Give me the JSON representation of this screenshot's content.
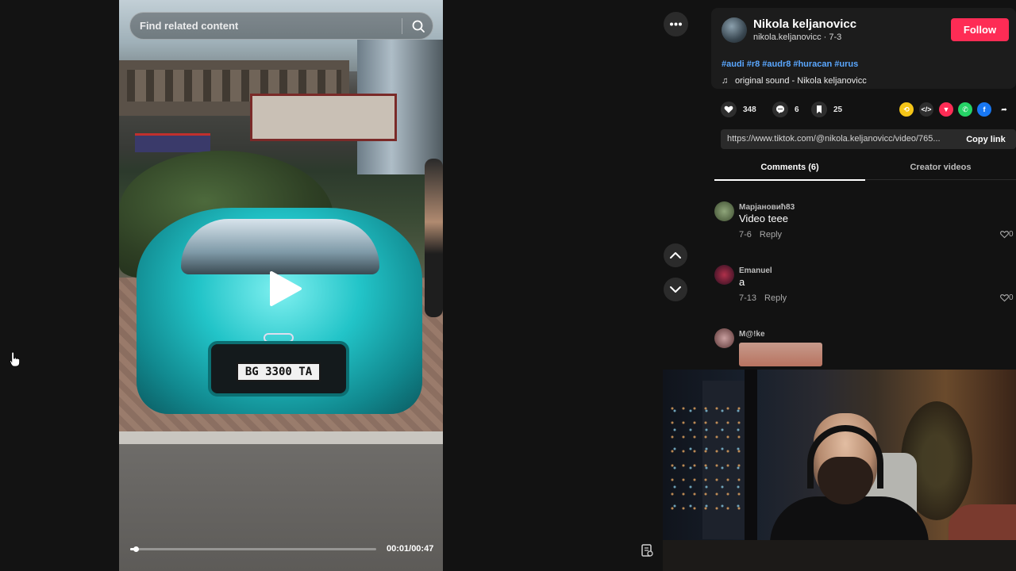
{
  "search": {
    "placeholder": "Find related content"
  },
  "video": {
    "plate_text": "BG 3300 TA",
    "time": "00:01/00:47",
    "progress": 0.021
  },
  "author": {
    "name": "Nikola keljanovicc",
    "handle_date": "nikola.keljanovicc · 7-3",
    "follow_label": "Follow"
  },
  "hashtags": [
    "#audi",
    "#r8",
    "#audr8",
    "#huracan",
    "#urus"
  ],
  "sound": "original sound - Nikola keljanovicc",
  "stats": {
    "likes": "348",
    "comments": "6",
    "saves": "25"
  },
  "share_icons": [
    "repost-icon",
    "embed-icon",
    "send-icon",
    "whatsapp-icon",
    "facebook-icon",
    "share-arrow-icon"
  ],
  "link": {
    "url": "https://www.tiktok.com/@nikola.keljanovicc/video/765...",
    "copy_label": "Copy link"
  },
  "tabs": [
    {
      "label": "Comments (6)",
      "active": true
    },
    {
      "label": "Creator videos",
      "active": false
    }
  ],
  "comments": [
    {
      "user": "Марјановић83",
      "text": "Video teee",
      "date": "7-6",
      "reply": "Reply",
      "likes": "0"
    },
    {
      "user": "Emanuel",
      "text": "a",
      "date": "7-13",
      "reply": "Reply",
      "likes": "0"
    },
    {
      "user": "M@!ke",
      "text": "",
      "date": "",
      "reply": "",
      "likes": ""
    }
  ],
  "colors": {
    "accent": "#fe2c55",
    "hashtag": "#5aa7ff",
    "panel_bg": "#121212"
  }
}
